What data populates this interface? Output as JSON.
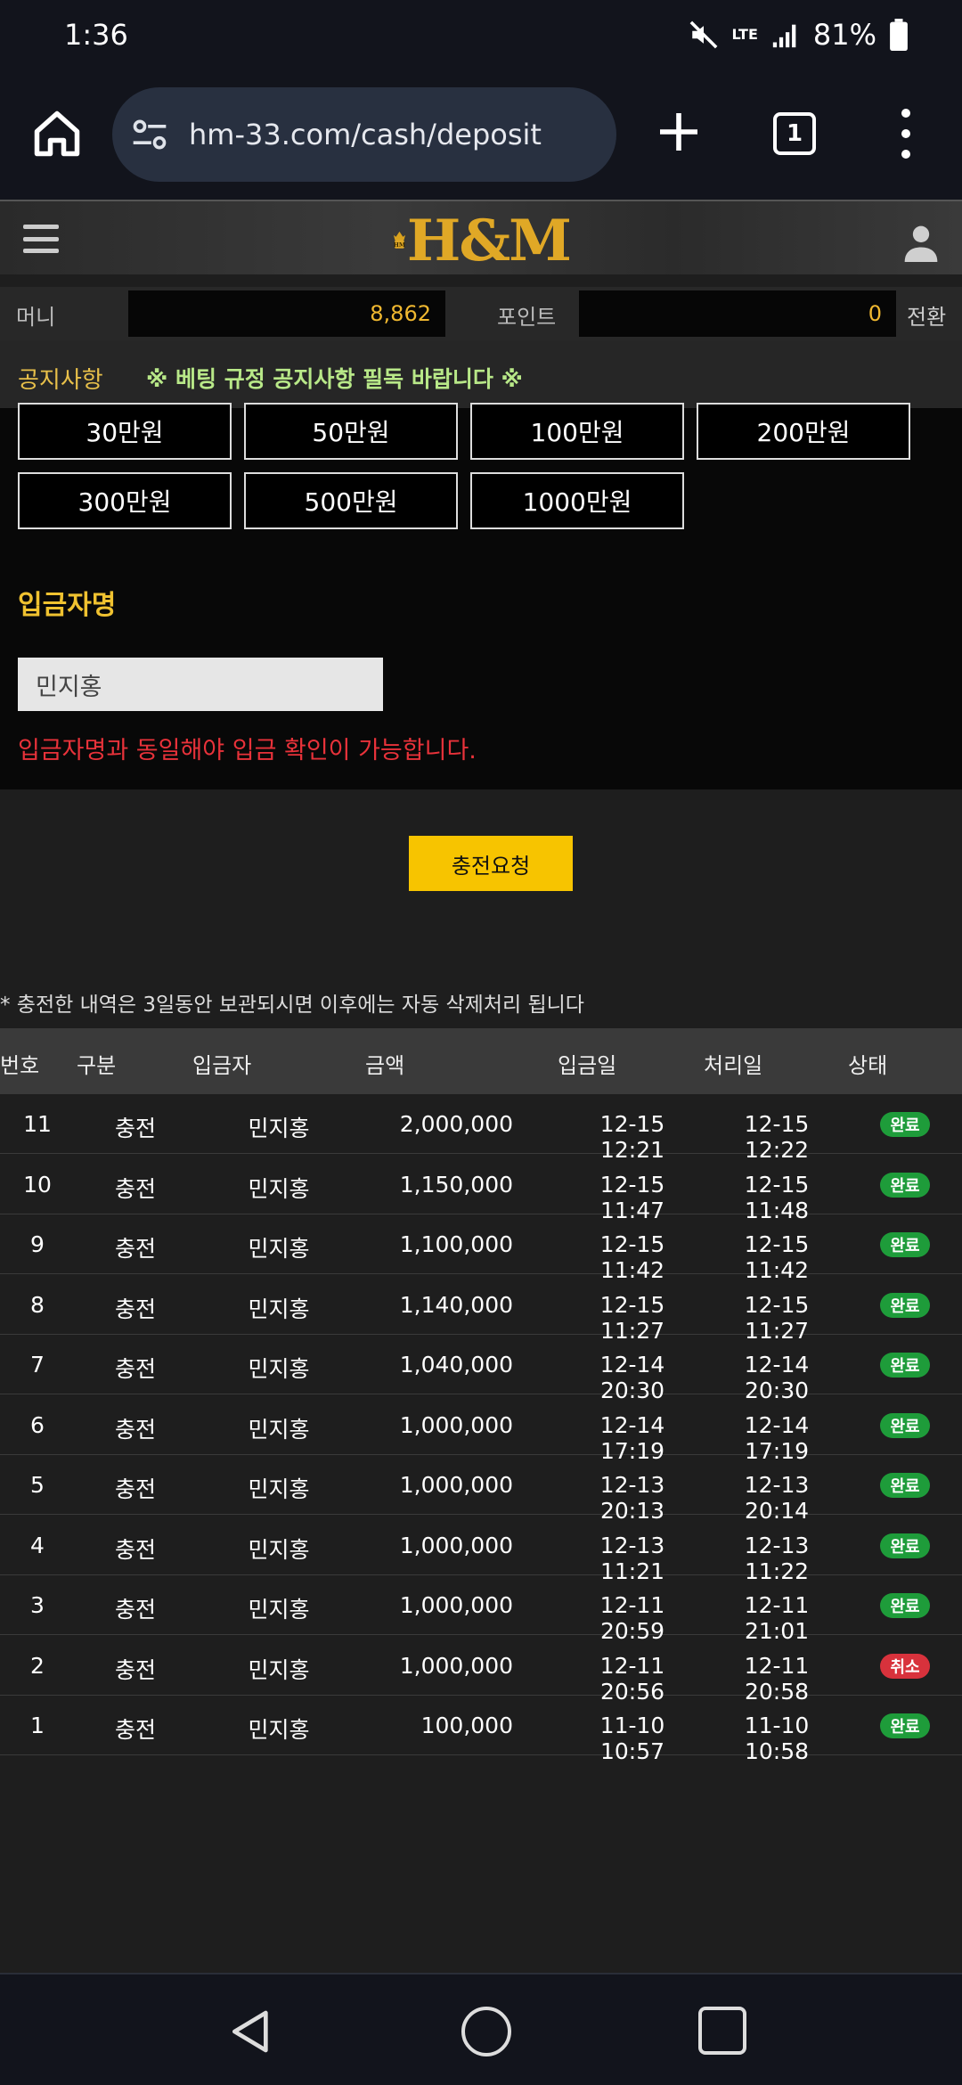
{
  "status_bar": {
    "time": "1:36",
    "network": "LTE",
    "battery": "81%",
    "mute_icon": "mute-icon",
    "signal_icon": "signal-icon",
    "battery_icon": "battery-icon"
  },
  "browser": {
    "url": "hm-33.com/cash/deposit",
    "tab_count": "1"
  },
  "site": {
    "logo_text": "H&M"
  },
  "balance": {
    "money_label": "머니",
    "money_value": "8,862",
    "point_label": "포인트",
    "point_value": "0",
    "convert_label": "전환"
  },
  "notice": {
    "label": "공지사항",
    "text": "※ 베팅 규정 공지사항 필독 바랍니다 ※"
  },
  "amount_buttons": [
    "30만원",
    "50만원",
    "100만원",
    "200만원",
    "300만원",
    "500만원",
    "1000만원"
  ],
  "form": {
    "depositor_label": "입금자명",
    "depositor_value": "민지홍",
    "warning": "입금자명과 동일해야 입금 확인이 가능합니다.",
    "submit_label": "충전요청"
  },
  "note": "* 충전한 내역은 3일동안 보관되시면 이후에는 자동 삭제처리 됩니다",
  "table": {
    "headers": [
      "번호",
      "구분",
      "입금자",
      "금액",
      "입금일",
      "처리일",
      "상태"
    ],
    "rows": [
      {
        "num": "11",
        "type": "충전",
        "name": "민지홍",
        "amount": "2,000,000",
        "in": "12-15 12:21",
        "proc": "12-15 12:22",
        "status": "완료"
      },
      {
        "num": "10",
        "type": "충전",
        "name": "민지홍",
        "amount": "1,150,000",
        "in": "12-15 11:47",
        "proc": "12-15 11:48",
        "status": "완료"
      },
      {
        "num": "9",
        "type": "충전",
        "name": "민지홍",
        "amount": "1,100,000",
        "in": "12-15 11:42",
        "proc": "12-15 11:42",
        "status": "완료"
      },
      {
        "num": "8",
        "type": "충전",
        "name": "민지홍",
        "amount": "1,140,000",
        "in": "12-15 11:27",
        "proc": "12-15 11:27",
        "status": "완료"
      },
      {
        "num": "7",
        "type": "충전",
        "name": "민지홍",
        "amount": "1,040,000",
        "in": "12-14 20:30",
        "proc": "12-14 20:30",
        "status": "완료"
      },
      {
        "num": "6",
        "type": "충전",
        "name": "민지홍",
        "amount": "1,000,000",
        "in": "12-14 17:19",
        "proc": "12-14 17:19",
        "status": "완료"
      },
      {
        "num": "5",
        "type": "충전",
        "name": "민지홍",
        "amount": "1,000,000",
        "in": "12-13 20:13",
        "proc": "12-13 20:14",
        "status": "완료"
      },
      {
        "num": "4",
        "type": "충전",
        "name": "민지홍",
        "amount": "1,000,000",
        "in": "12-13 11:21",
        "proc": "12-13 11:22",
        "status": "완료"
      },
      {
        "num": "3",
        "type": "충전",
        "name": "민지홍",
        "amount": "1,000,000",
        "in": "12-11 20:59",
        "proc": "12-11 21:01",
        "status": "완료"
      },
      {
        "num": "2",
        "type": "충전",
        "name": "민지홍",
        "amount": "1,000,000",
        "in": "12-11 20:56",
        "proc": "12-11 20:58",
        "status": "취소"
      },
      {
        "num": "1",
        "type": "충전",
        "name": "민지홍",
        "amount": "100,000",
        "in": "11-10 10:57",
        "proc": "11-10 10:58",
        "status": "완료"
      }
    ]
  },
  "colors": {
    "accent": "#f7c400",
    "status_done": "#1e9c3a",
    "status_cancel": "#d8323c",
    "warning": "#e8323a"
  }
}
